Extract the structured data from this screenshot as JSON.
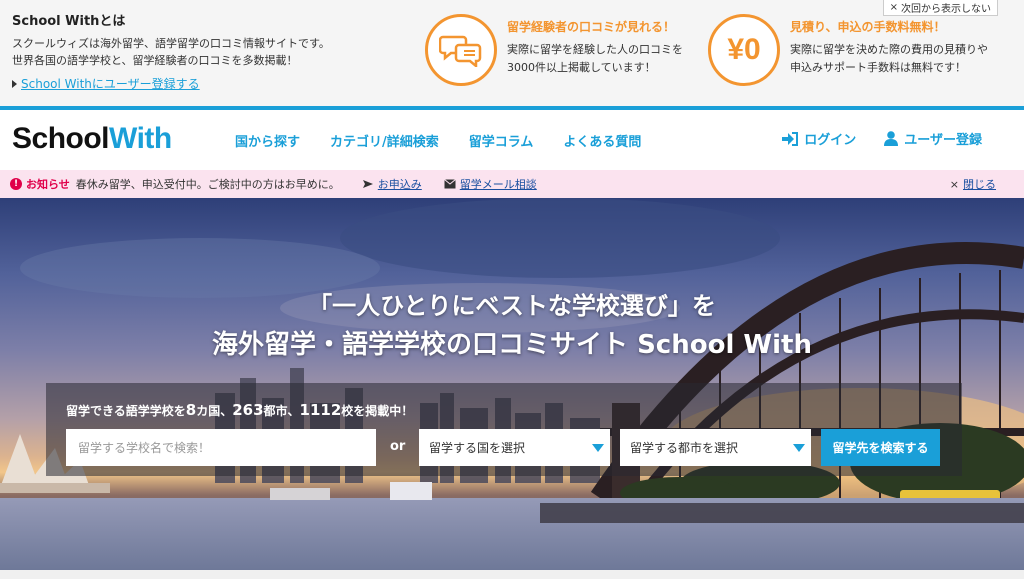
{
  "info_banner": {
    "title": "School Withとは",
    "desc_line1": "スクールウィズは海外留学、語学留学の口コミ情報サイトです。",
    "desc_line2": "世界各国の語学学校と、留学経験者の口コミを多数掲載！",
    "register_link": "School Withにユーザー登録する",
    "close_label": "次回から表示しない",
    "features": [
      {
        "icon": "speech-bubbles-icon",
        "title": "留学経験者の口コミが見れる！",
        "desc_line1": "実際に留学を経験した人の口コミを",
        "desc_line2": "3000件以上掲載しています！"
      },
      {
        "icon": "yen-zero-icon",
        "icon_text": "¥0",
        "title": "見積り、申込の手数料無料！",
        "desc_line1": "実際に留学を決めた際の費用の見積りや",
        "desc_line2": "申込みサポート手数料は無料です！"
      }
    ]
  },
  "header": {
    "logo_part1": "School",
    "logo_part2": "With",
    "nav": [
      "国から探す",
      "カテゴリ/詳細検索",
      "留学コラム",
      "よくある質問"
    ],
    "login": "ログイン",
    "register": "ユーザー登録"
  },
  "notice": {
    "label": "お知らせ",
    "text": "春休み留学、申込受付中。ご検討中の方はお早めに。",
    "apply_link": "お申込み",
    "mail_link": "留学メール相談",
    "close": "閉じる"
  },
  "hero": {
    "title_line1": "「一人ひとりにベストな学校選び」を",
    "title_line2": "海外留学・語学学校の口コミサイト School With",
    "count_prefix": "留学できる語学学校を",
    "count_countries": "8",
    "count_countries_unit": "カ国、",
    "count_cities": "263",
    "count_cities_unit": "都市、",
    "count_schools": "1112",
    "count_schools_unit": "校を掲載中！",
    "search_placeholder": "留学する学校名で検索！",
    "or_label": "or",
    "country_select": "留学する国を選択",
    "city_select": "留学する都市を選択",
    "search_button": "留学先を検索する"
  },
  "colors": {
    "brand_blue": "#1a9fd8",
    "accent_orange": "#f39530",
    "notice_red": "#e0004a",
    "notice_bg": "#fbe3ef"
  }
}
